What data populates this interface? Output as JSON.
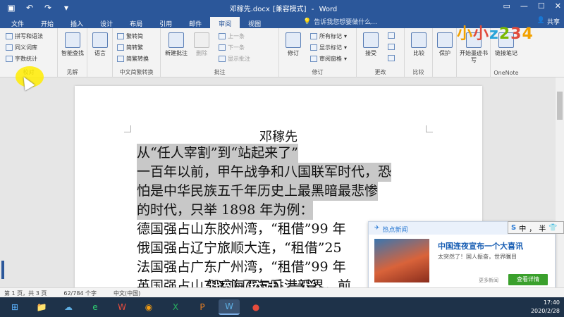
{
  "window": {
    "title": "邓稼先.docx",
    "mode": "[兼容模式]",
    "app": "Word",
    "help_search": "告诉我您想要做什么...",
    "share": "共享"
  },
  "tabs": [
    "文件",
    "开始",
    "插入",
    "设计",
    "布局",
    "引用",
    "邮件",
    "审阅",
    "视图"
  ],
  "ribbon": {
    "proofing": {
      "items": [
        "拼写和语法",
        "同义词库",
        "字数统计"
      ],
      "label": "校对"
    },
    "insights": {
      "button": "智能查找",
      "label": "见解"
    },
    "language": {
      "button": "语言"
    },
    "chinese": {
      "items": [
        "繁转简",
        "简转繁",
        "简繁转换"
      ],
      "label": "中文简繁转换"
    },
    "comments": {
      "new": "新建批注",
      "delete": "删除",
      "prev": "上一条",
      "next": "下一条",
      "show": "显示批注",
      "label": "批注"
    },
    "tracking": {
      "track": "修订",
      "markup": "所有标记",
      "show_markup": "显示标记",
      "pane": "审阅窗格",
      "label": "修订"
    },
    "changes": {
      "accept": "接受",
      "label": "更改"
    },
    "compare": {
      "button": "比较",
      "label": "比较"
    },
    "protect": {
      "button": "保护"
    },
    "ink": {
      "button": "开始墨迹书写"
    },
    "onenote": {
      "button": "链接笔记",
      "label": "OneNote"
    }
  },
  "logo": [
    "小",
    "小",
    "z",
    "2",
    "3",
    "4"
  ],
  "document": {
    "heading": "邓稼先",
    "lines": [
      "从“任人宰割”到“站起来了”",
      "一百年以前，甲午战争和八国联军时代，恐",
      "怕是中华民族五千年历史上最黑暗最悲惨",
      "的时代，只举 1898 年为例：",
      "德国强占山东胶州湾，“租借”99 年",
      "俄国强占辽宁旅顺大连，“租借”25",
      "法国强占广东广州湾，“租借”99 年",
      "英国强占山东威海卫与香港新界，前"
    ]
  },
  "popup": {
    "header": "热点新闻",
    "title": "中国连夜宣布一个大喜讯",
    "subtitle": "太突然了！国人振奋，世界瞩目",
    "more": "更多新闻",
    "button": "查看详情"
  },
  "ime": {
    "mode": "中",
    "punct": "，",
    "width": "半"
  },
  "subtitle_text": "找到【校对】一栏",
  "status": {
    "page": "第 1 页，共 3 页",
    "words": "62/784 个字",
    "lang": "中文(中国)"
  },
  "taskbar": {
    "apps": [
      "⊞",
      "📁",
      "☁",
      "e",
      "W",
      "◉",
      "X",
      "P",
      "W",
      "●"
    ],
    "time": "17:40",
    "date": "2020/2/28"
  },
  "colors": {
    "accent": "#2b579a",
    "selection": "#c8c8c8",
    "highlight": "#ffec00"
  }
}
